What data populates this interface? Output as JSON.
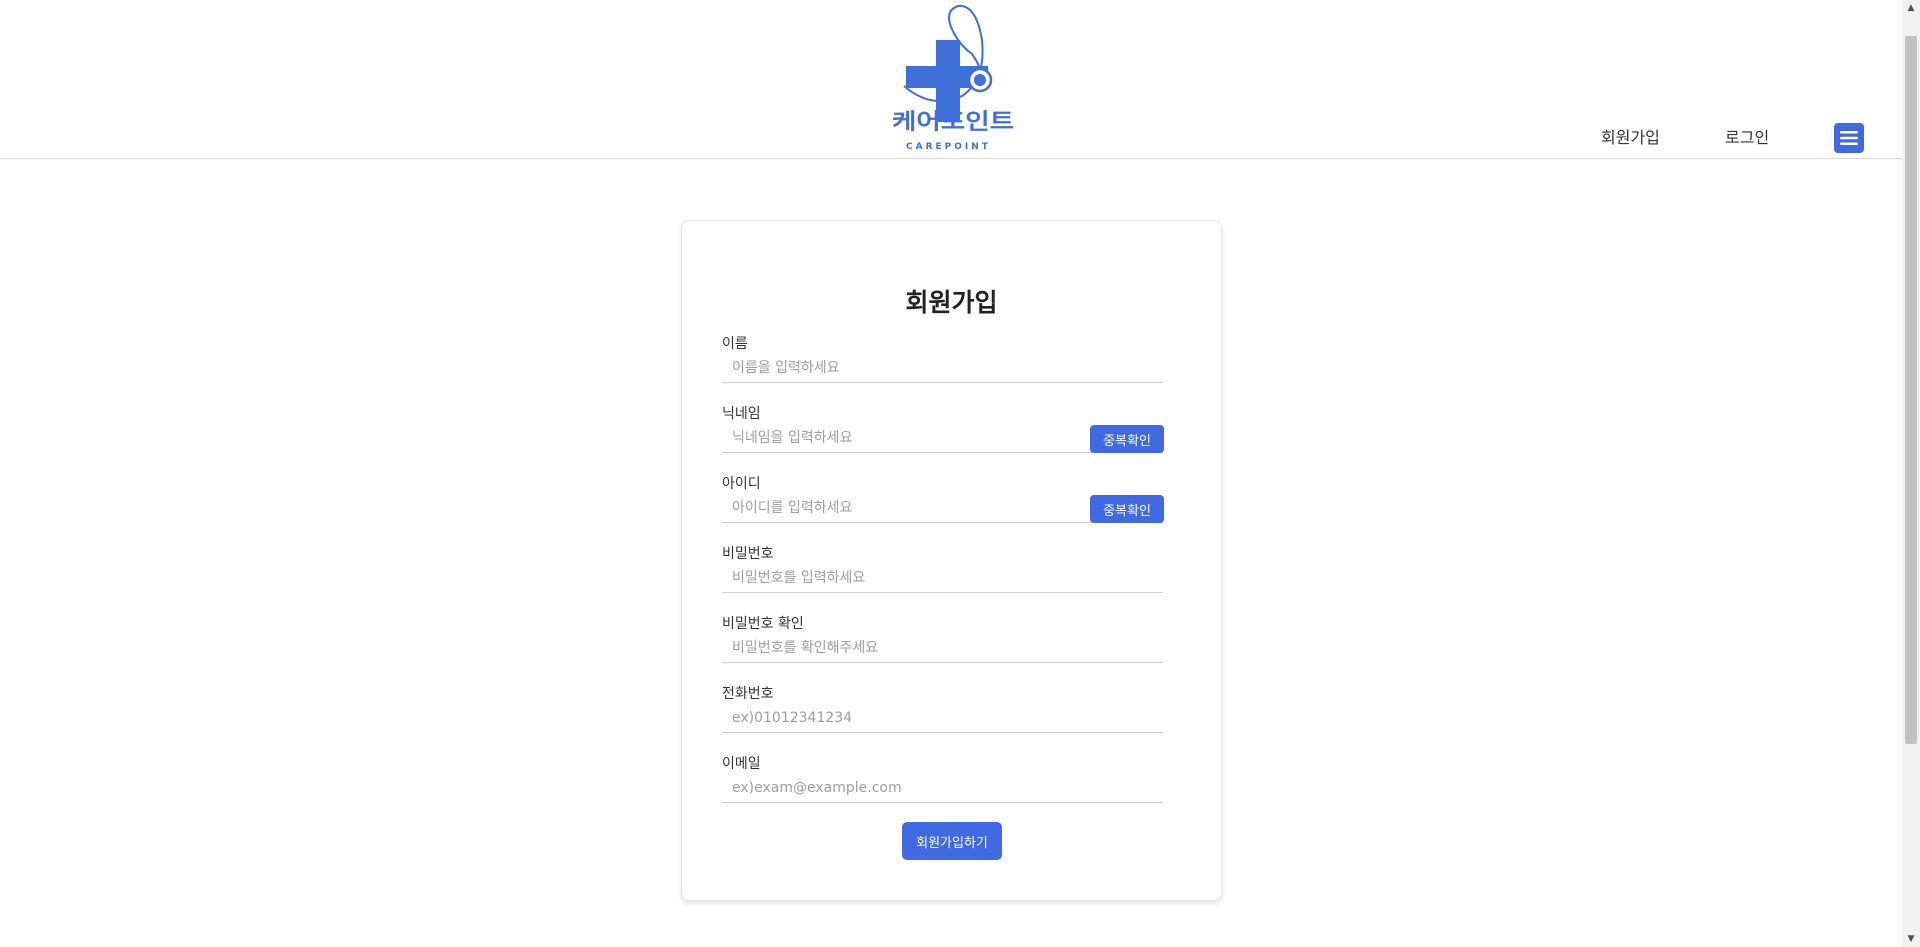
{
  "header": {
    "logo": {
      "korean_text": "케어포인트",
      "english_text": "CAREPOINT",
      "brand_color": "#4a7de0",
      "icon": "medical-cross-stethoscope-icon"
    },
    "nav": {
      "signup_label": "회원가입",
      "login_label": "로그인"
    },
    "menu_icon": "hamburger-menu-icon"
  },
  "form": {
    "title": "회원가입",
    "fields": [
      {
        "label": "이름",
        "placeholder": "이름을 입력하세요",
        "value": ""
      },
      {
        "label": "닉네임",
        "placeholder": "닉네임을 입력하세요",
        "value": "",
        "check_label": "중복확인"
      },
      {
        "label": "아이디",
        "placeholder": "아이디를 입력하세요",
        "value": "",
        "check_label": "중복확인"
      },
      {
        "label": "비밀번호",
        "placeholder": "비밀번호를 입력하세요",
        "value": ""
      },
      {
        "label": "비밀번호 확인",
        "placeholder": "비밀번호를 확인해주세요",
        "value": ""
      },
      {
        "label": "전화번호",
        "placeholder": "ex)01012341234",
        "value": ""
      },
      {
        "label": "이메일",
        "placeholder": "ex)exam@example.com",
        "value": ""
      }
    ],
    "submit_label": "회원가입하기"
  },
  "colors": {
    "accent": "#4169e1",
    "divider": "#d6d6d6"
  }
}
